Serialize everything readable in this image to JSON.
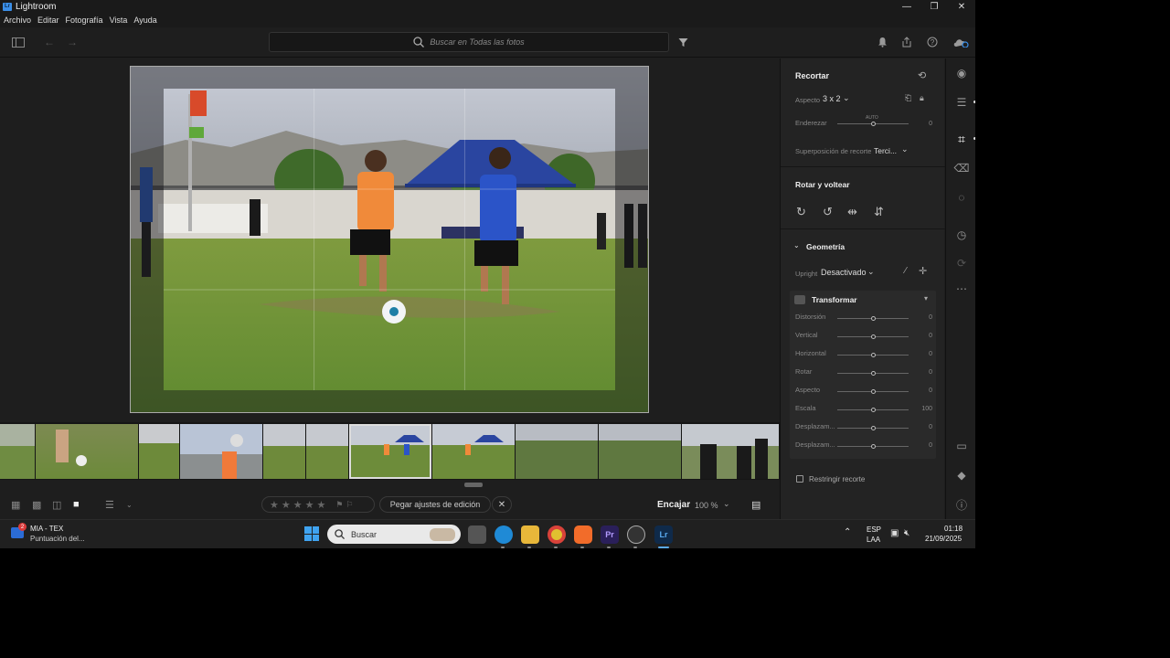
{
  "window": {
    "title": "Lightroom",
    "logo": "Lr",
    "controls": [
      "—",
      "❐",
      "✕"
    ]
  },
  "menu": [
    "Archivo",
    "Editar",
    "Fotografía",
    "Vista",
    "Ayuda"
  ],
  "toolbar": {
    "search_placeholder": "Buscar en Todas las fotos"
  },
  "crop_panel": {
    "title": "Recortar",
    "aspect_label": "Aspecto",
    "aspect_value": "3 x 2",
    "straighten_label": "Enderezar",
    "straighten_auto": "AUTO",
    "straighten_value": "0",
    "overlay_label": "Superposición de recorte",
    "overlay_value": "Terci..."
  },
  "rotate_panel": {
    "title": "Rotar y voltear"
  },
  "geometry_panel": {
    "title": "Geometría",
    "upright_label": "Upright",
    "upright_value": "Desactivado",
    "transform_title": "Transformar",
    "sliders": [
      {
        "label": "Distorsión",
        "value": "0"
      },
      {
        "label": "Vertical",
        "value": "0"
      },
      {
        "label": "Horizontal",
        "value": "0"
      },
      {
        "label": "Rotar",
        "value": "0"
      },
      {
        "label": "Aspecto",
        "value": "0"
      },
      {
        "label": "Escala",
        "value": "100"
      },
      {
        "label": "Desplazam...",
        "value": "0"
      },
      {
        "label": "Desplazam...",
        "value": "0"
      }
    ],
    "constrain_label": "Restringir recorte"
  },
  "bottom": {
    "paste_label": "Pegar ajustes de edición",
    "fit_label": "Encajar",
    "zoom_value": "100 %"
  },
  "taskbar": {
    "notification_count": "2",
    "notification_title": "MIA - TEX",
    "notification_sub": "Puntuación del...",
    "search_label": "Buscar",
    "lang_top": "ESP",
    "lang_bottom": "LAA",
    "time": "01:18",
    "date": "21/09/2025"
  },
  "colors": {
    "accent": "#3b8fe8",
    "panel": "#232323",
    "background": "#1e1e1e"
  }
}
